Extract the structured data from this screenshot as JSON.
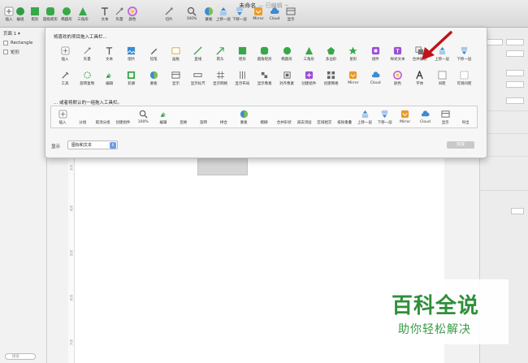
{
  "window": {
    "title": "未命名",
    "subtitle": " — 已编辑 ~"
  },
  "toolbar": [
    {
      "label": "插入",
      "icon": "plus-icon",
      "color": "#777"
    },
    {
      "label": "编组",
      "icon": "group-icon",
      "color": "#2e9c43"
    },
    {
      "label": "矩形",
      "icon": "rectangle-icon",
      "color": "#37a847"
    },
    {
      "label": "圆角矩形",
      "icon": "rounded-rect-icon",
      "color": "#37a847"
    },
    {
      "label": "椭圆形",
      "icon": "oval-icon",
      "color": "#37a847"
    },
    {
      "label": "三角形",
      "icon": "triangle-icon",
      "color": "#37a847"
    },
    {
      "label": "文本",
      "icon": "text-icon",
      "color": "#555"
    },
    {
      "label": "矢量",
      "icon": "vector-icon",
      "color": "#777"
    },
    {
      "label": "颜色",
      "icon": "color-wheel-icon",
      "color": "#c56bd6"
    },
    {
      "label": "切片",
      "icon": "slice-icon",
      "color": "#777"
    },
    {
      "label": "100%",
      "icon": "zoom-icon",
      "color": "#555"
    },
    {
      "label": "蒙板",
      "icon": "mask-icon",
      "color": "#3b8bd1"
    },
    {
      "label": "上移一层",
      "icon": "forward-icon",
      "color": "#3b8bd1"
    },
    {
      "label": "下移一层",
      "icon": "backward-icon",
      "color": "#3b8bd1"
    },
    {
      "label": "Mirror",
      "icon": "mirror-icon",
      "color": "#e99b2a"
    },
    {
      "label": "Cloud",
      "icon": "cloud-icon",
      "color": "#3b8bd1"
    },
    {
      "label": "显示",
      "icon": "view-icon",
      "color": "#666"
    }
  ],
  "sidebar": {
    "page": "页面 1 ▾",
    "layers": [
      "Rectangle",
      "矩形"
    ],
    "search_placeholder": "搜索"
  },
  "sheet": {
    "heading": "将喜欢的项目拖入工具栏...",
    "row1": [
      {
        "label": "插入",
        "icon": "plus-icon",
        "color": "#888"
      },
      {
        "label": "矢量",
        "icon": "vector-icon",
        "color": "#888"
      },
      {
        "label": "文本",
        "icon": "text-icon",
        "color": "#555"
      },
      {
        "label": "图片",
        "icon": "image-icon",
        "color": "#3b8bd1"
      },
      {
        "label": "铅笔",
        "icon": "pencil-icon",
        "color": "#555"
      },
      {
        "label": "画板",
        "icon": "artboard-icon",
        "color": "#d9a83b"
      },
      {
        "label": "直线",
        "icon": "line-icon",
        "color": "#2e9c43"
      },
      {
        "label": "箭头",
        "icon": "arrow-icon",
        "color": "#2e9c43"
      },
      {
        "label": "矩形",
        "icon": "rectangle-icon",
        "color": "#37a847"
      },
      {
        "label": "圆角矩形",
        "icon": "rounded-rect-icon",
        "color": "#37a847"
      },
      {
        "label": "椭圆形",
        "icon": "oval-icon",
        "color": "#37a847"
      },
      {
        "label": "三角形",
        "icon": "triangle-icon",
        "color": "#37a847"
      },
      {
        "label": "多边形",
        "icon": "polygon-icon",
        "color": "#37a847"
      },
      {
        "label": "星形",
        "icon": "star-icon",
        "color": "#37a847"
      },
      {
        "label": "组件",
        "icon": "component-icon",
        "color": "#9b4fd6"
      },
      {
        "label": "样式文本",
        "icon": "styled-text-icon",
        "color": "#9b4fd6"
      },
      {
        "label": "合并形状",
        "icon": "combine-icon",
        "color": "#777"
      },
      {
        "label": "上移一层",
        "icon": "forward-icon",
        "color": "#3b8bd1"
      },
      {
        "label": "下移一层",
        "icon": "backward-icon",
        "color": "#3b8bd1"
      }
    ],
    "row2": [
      {
        "label": "工具",
        "icon": "tools-icon",
        "color": "#666"
      },
      {
        "label": "旋转复制",
        "icon": "rotate-copy-icon",
        "color": "#2e9c43"
      },
      {
        "label": "编辑",
        "icon": "edit-icon",
        "color": "#2e9c43"
      },
      {
        "label": "轮廓",
        "icon": "outline-icon",
        "color": "#37a847"
      },
      {
        "label": "蒙板",
        "icon": "mask-icon",
        "color": "#3b8bd1"
      },
      {
        "label": "显示",
        "icon": "view-icon",
        "color": "#666"
      },
      {
        "label": "显示标尺",
        "icon": "ruler-icon",
        "color": "#666"
      },
      {
        "label": "显示网格",
        "icon": "grid-icon",
        "color": "#666"
      },
      {
        "label": "显示布局",
        "icon": "layout-icon",
        "color": "#666"
      },
      {
        "label": "显示像素",
        "icon": "pixel-icon",
        "color": "#666"
      },
      {
        "label": "对齐像素",
        "icon": "snap-pixel-icon",
        "color": "#666"
      },
      {
        "label": "创建组件",
        "icon": "create-component-icon",
        "color": "#9b4fd6"
      },
      {
        "label": "创建网格",
        "icon": "create-grid-icon",
        "color": "#666"
      },
      {
        "label": "Mirror",
        "icon": "mirror-icon",
        "color": "#e99b2a"
      },
      {
        "label": "Cloud",
        "icon": "cloud-icon",
        "color": "#3b8bd1"
      },
      {
        "label": "颜色",
        "icon": "color-wheel-icon",
        "color": "#c56bd6"
      },
      {
        "label": "字体",
        "icon": "font-icon",
        "color": "#333"
      },
      {
        "label": "间距",
        "icon": "space-icon",
        "color": "#999"
      },
      {
        "label": "可调间距",
        "icon": "flex-space-icon",
        "color": "#999"
      }
    ],
    "default_heading": "... 或者将默认的一组拖入工具栏。",
    "default_set": [
      {
        "label": "插入",
        "icon": "plus-icon",
        "color": "#888"
      },
      {
        "label": "分组",
        "icon": "none",
        "color": "#888"
      },
      {
        "label": "取消分组",
        "icon": "none",
        "color": "#888"
      },
      {
        "label": "创建组件",
        "icon": "none",
        "color": "#888"
      },
      {
        "label": "100%",
        "icon": "zoom-icon",
        "color": "#555"
      },
      {
        "label": "编辑",
        "icon": "edit-icon",
        "color": "#2e9c43"
      },
      {
        "label": "变换",
        "icon": "none",
        "color": "#888"
      },
      {
        "label": "旋转",
        "icon": "none",
        "color": "#888"
      },
      {
        "label": "拼合",
        "icon": "none",
        "color": "#888"
      },
      {
        "label": "蒙板",
        "icon": "mask-icon",
        "color": "#3b8bd1"
      },
      {
        "label": "模糊",
        "icon": "none",
        "color": "#888"
      },
      {
        "label": "合并形状",
        "icon": "none",
        "color": "#888"
      },
      {
        "label": "减去顶层",
        "icon": "none",
        "color": "#888"
      },
      {
        "label": "区域相交",
        "icon": "none",
        "color": "#888"
      },
      {
        "label": "排除重叠",
        "icon": "none",
        "color": "#888"
      },
      {
        "label": "上移一层",
        "icon": "forward-icon",
        "color": "#3b8bd1"
      },
      {
        "label": "下移一层",
        "icon": "backward-icon",
        "color": "#3b8bd1"
      },
      {
        "label": "Mirror",
        "icon": "mirror-icon",
        "color": "#e99b2a"
      },
      {
        "label": "Cloud",
        "icon": "cloud-icon",
        "color": "#3b8bd1"
      },
      {
        "label": "显示",
        "icon": "view-icon",
        "color": "#666"
      },
      {
        "label": "导出",
        "icon": "none",
        "color": "#888"
      }
    ],
    "show_label": "显示",
    "show_value": "图标和文本",
    "done_label": "完成"
  },
  "ruler_marks": [
    "300",
    "400",
    "500",
    "600",
    "700"
  ],
  "watermark": {
    "line1": "百科全说",
    "line2": "助你轻松解决"
  }
}
